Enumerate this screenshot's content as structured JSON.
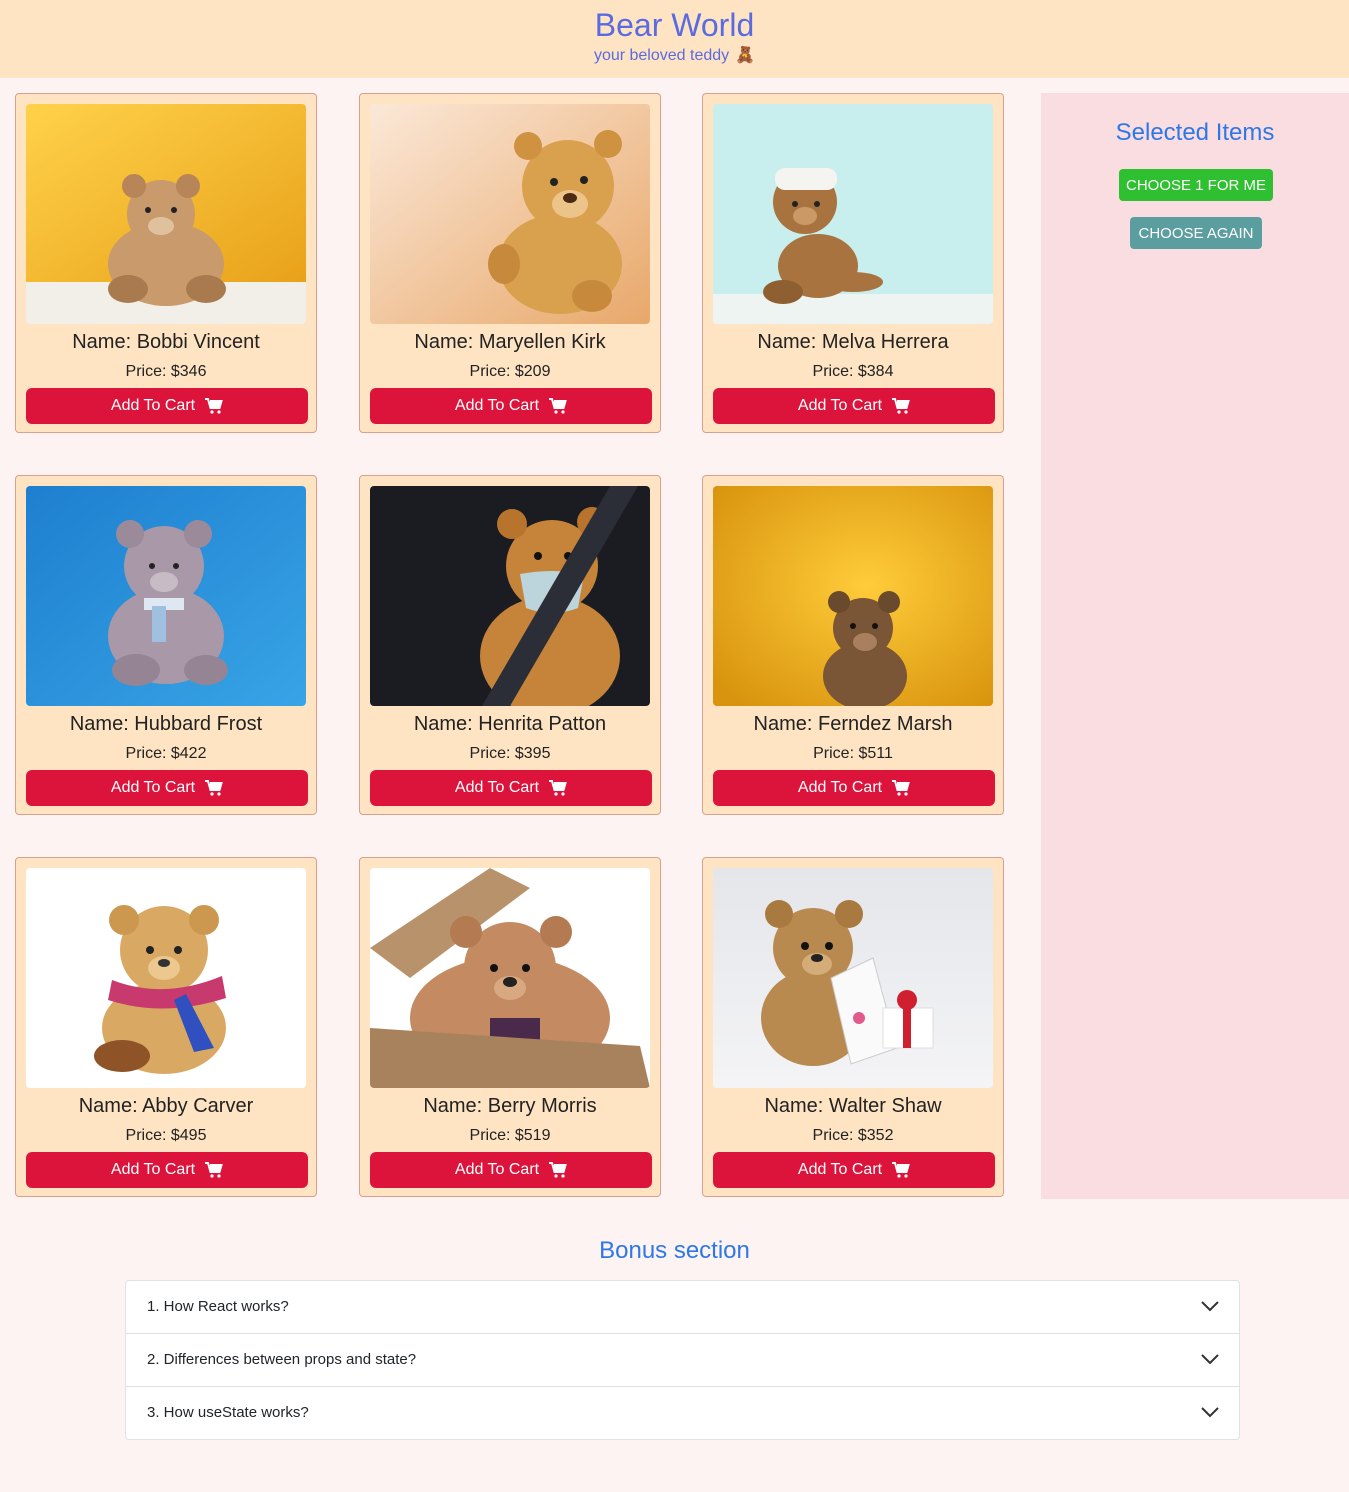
{
  "header": {
    "title": "Bear World",
    "subtitle": "your beloved teddy",
    "subtitle_emoji": "🧸"
  },
  "products": [
    {
      "name": "Name: Bobbi Vincent",
      "price": "Price: $346",
      "button": "Add To Cart",
      "image": "teddy-yellow-bg"
    },
    {
      "name": "Name: Maryellen Kirk",
      "price": "Price: $209",
      "button": "Add To Cart",
      "image": "teddy-peach-bg"
    },
    {
      "name": "Name: Melva Herrera",
      "price": "Price: $384",
      "button": "Add To Cart",
      "image": "teddy-bandaged-mint-bg"
    },
    {
      "name": "Name: Hubbard Frost",
      "price": "Price: $422",
      "button": "Add To Cart",
      "image": "teddy-grey-blue-bg"
    },
    {
      "name": "Name: Henrita Patton",
      "price": "Price: $395",
      "button": "Add To Cart",
      "image": "teddy-mask-car-seat"
    },
    {
      "name": "Name: Ferndez Marsh",
      "price": "Price: $511",
      "button": "Add To Cart",
      "image": "teddy-brown-yellow-bg"
    },
    {
      "name": "Name: Abby Carver",
      "price": "Price: $495",
      "button": "Add To Cart",
      "image": "teddy-scarf-white-bg"
    },
    {
      "name": "Name: Berry Morris",
      "price": "Price: $519",
      "button": "Add To Cart",
      "image": "teddy-in-box"
    },
    {
      "name": "Name: Walter Shaw",
      "price": "Price: $352",
      "button": "Add To Cart",
      "image": "teddy-gift-card"
    }
  ],
  "sidebar": {
    "title": "Selected Items",
    "choose_button": "CHOOSE 1 FOR ME",
    "again_button": "CHOOSE AGAIN"
  },
  "bonus": {
    "title": "Bonus section",
    "items": [
      {
        "label": "1. How React works?"
      },
      {
        "label": "2. Differences between props and state?"
      },
      {
        "label": "3. How useState works?"
      }
    ]
  },
  "colors": {
    "header_bg": "#ffe4c4",
    "title": "#5a6be0",
    "card_bg": "#ffe4c4",
    "button": "#dc143c",
    "sidebar_bg": "#f9dde0",
    "choose_button": "#2ec030",
    "again_button": "#5b9ea0",
    "accent_blue": "#2e78e6"
  }
}
